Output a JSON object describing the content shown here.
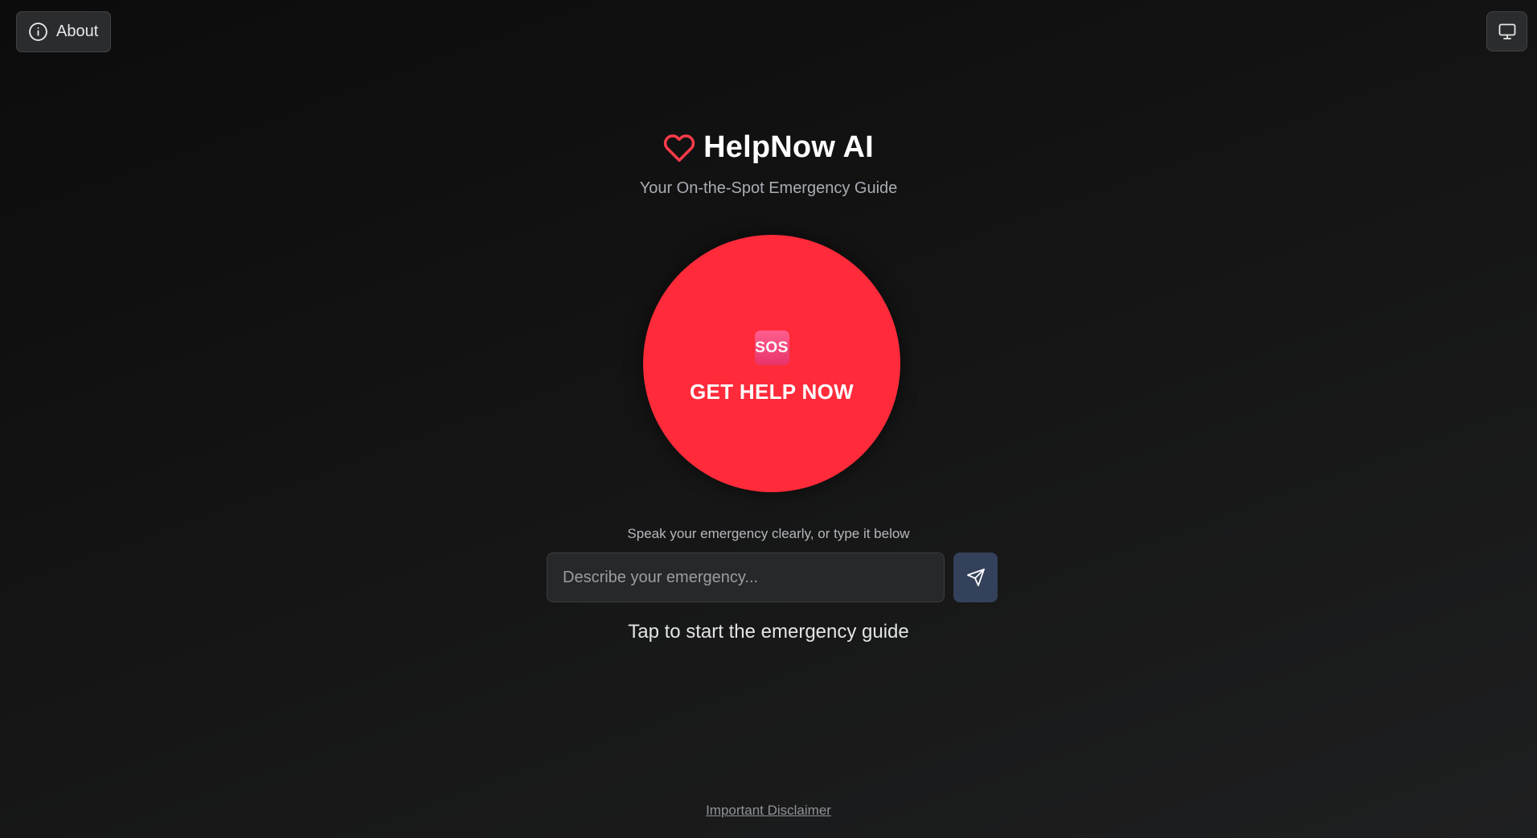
{
  "top_bar": {
    "about_label": "About",
    "about_icon": "info-icon",
    "display_icon": "monitor-icon"
  },
  "header": {
    "title": "HelpNow AI",
    "subtitle": "Your On-the-Spot Emergency Guide",
    "logo_icon": "heart-icon"
  },
  "sos_button": {
    "badge": "SOS",
    "label": "GET HELP NOW",
    "color": "#ff2b3a"
  },
  "input_section": {
    "hint": "Speak your emergency clearly, or type it below",
    "placeholder": "Describe your emergency...",
    "value": "",
    "send_icon": "send-icon"
  },
  "status_text": "Tap to start the emergency guide",
  "footer": {
    "disclaimer_link": "Important Disclaimer"
  },
  "colors": {
    "accent": "#ff2b3a",
    "heart": "#ff3b4a",
    "send_button": "#34415a"
  }
}
